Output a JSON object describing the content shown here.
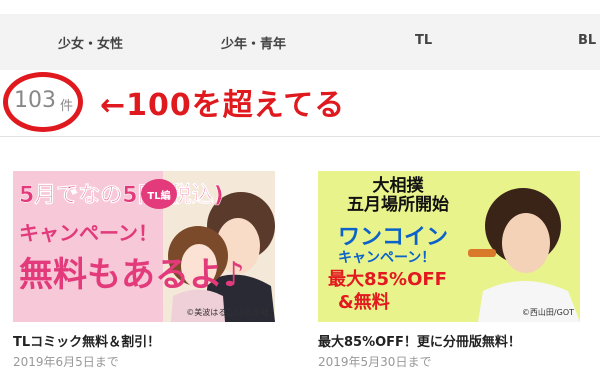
{
  "tabs": [
    "少女・女性",
    "少年・青年",
    "TL",
    "BL"
  ],
  "result": {
    "count": "103",
    "unit": "件",
    "annotation": "←100を超えてる"
  },
  "cards": [
    {
      "title": "TLコミック無料＆割引！",
      "date": "2019年6月5日まで",
      "banner": {
        "line1": "5月でなの5円(税込)",
        "badge": "TL編",
        "line2": "キャンペーン！",
        "line3": "無料もあるよ♪",
        "credit": "©美波はるこ/ぶんか社"
      }
    },
    {
      "title": "最大85%OFF！更に分冊版無料！",
      "date": "2019年5月30日まで",
      "banner": {
        "line1": "大相撲\n五月場所開始",
        "line2": "ワンコイン",
        "line3": "キャンペーン！",
        "line4": "最大85%OFF",
        "line5": "&無料",
        "credit": "©西山田/GOT"
      }
    }
  ]
}
